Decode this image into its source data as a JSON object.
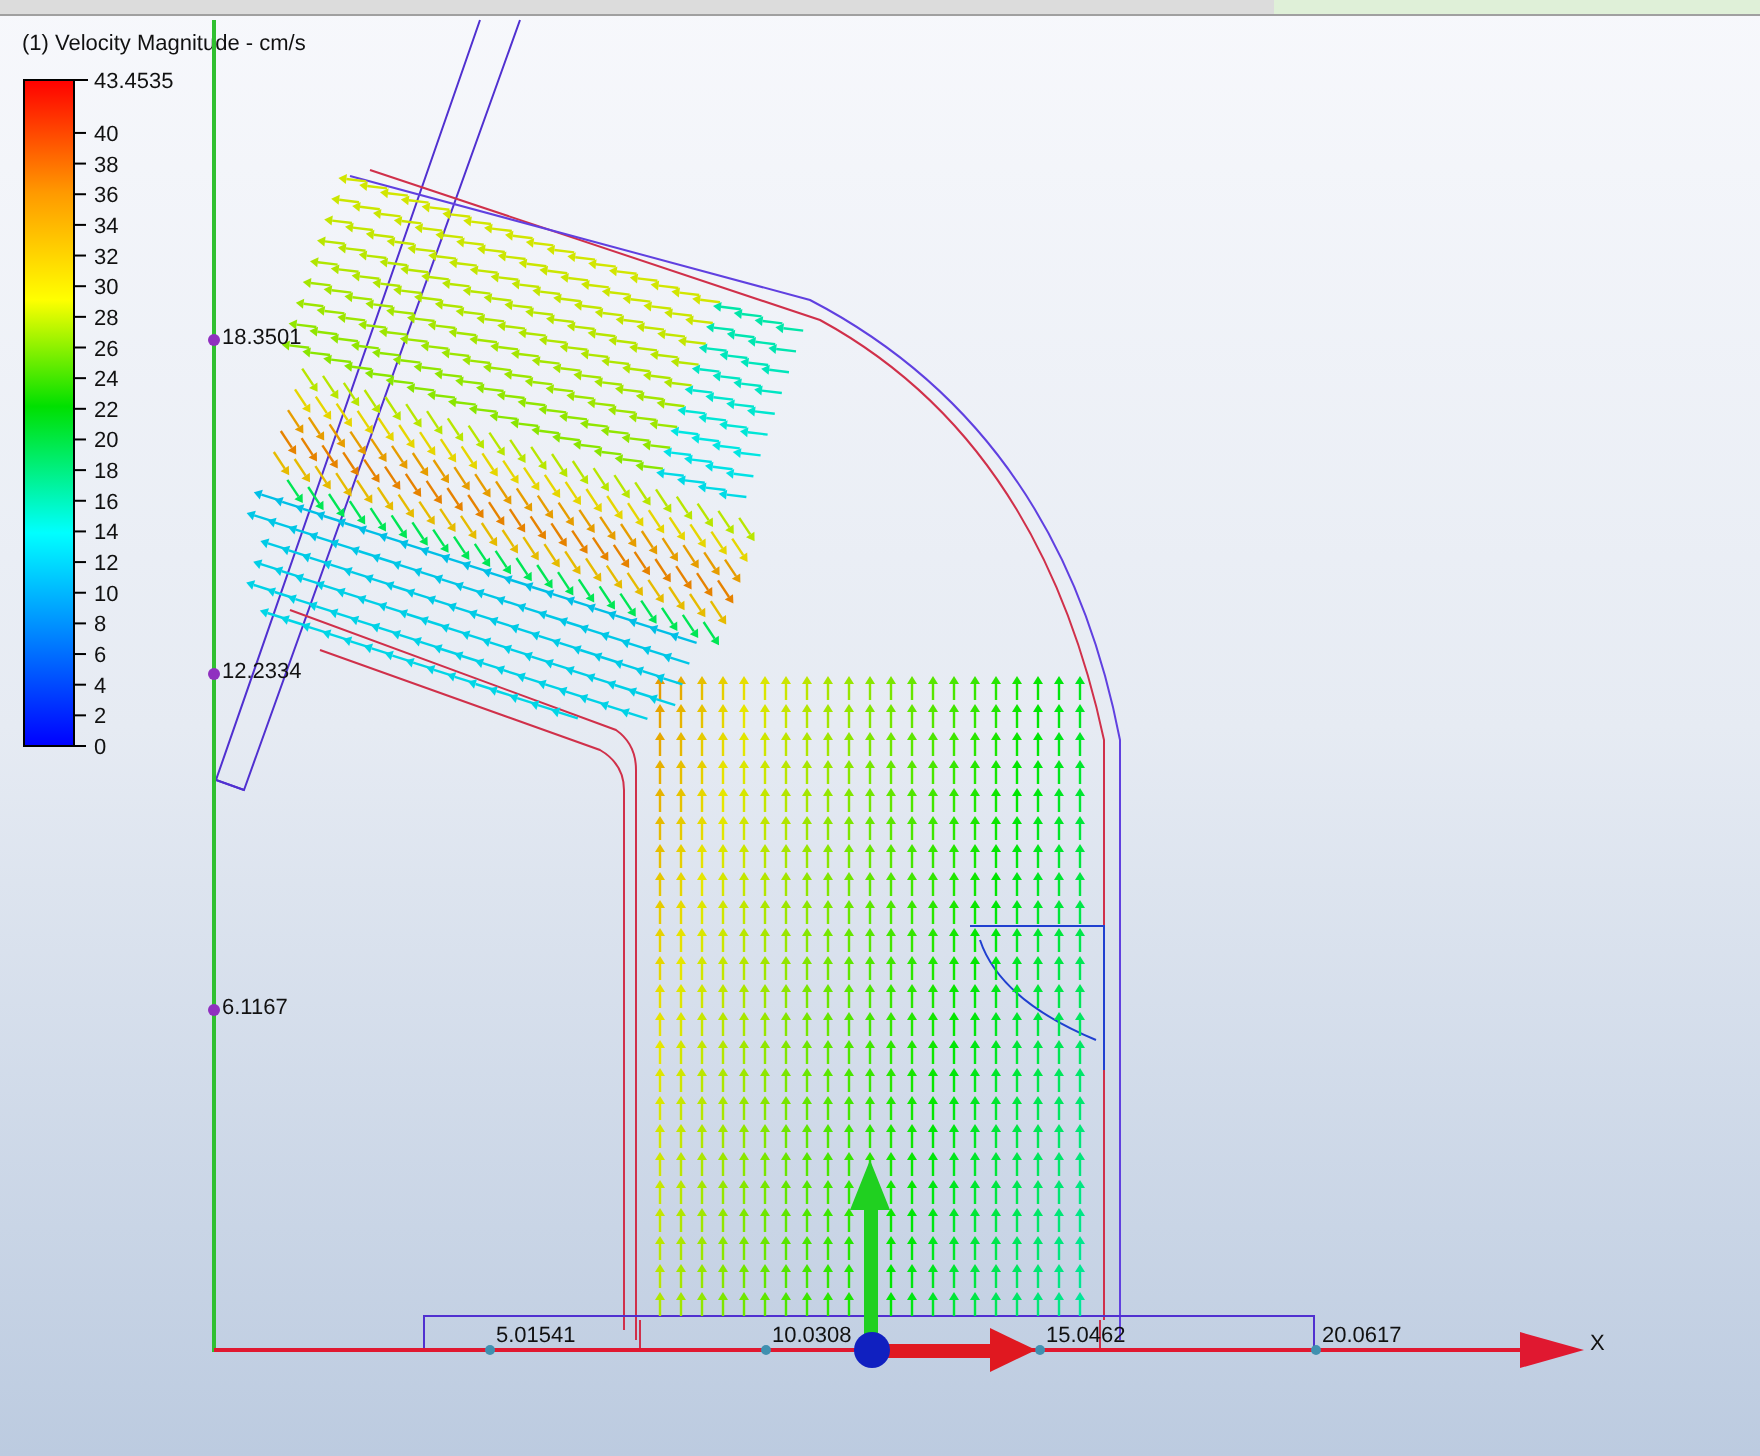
{
  "legend": {
    "title": "(1) Velocity Magnitude - cm/s",
    "max_label": "43.4535",
    "ticks": [
      "40",
      "38",
      "36",
      "34",
      "32",
      "30",
      "28",
      "26",
      "24",
      "22",
      "20",
      "18",
      "16",
      "14",
      "12",
      "10",
      "8",
      "6",
      "4",
      "2",
      "0"
    ]
  },
  "y_axis": {
    "ticks": [
      "18.3501",
      "12.2334",
      "6.1167"
    ]
  },
  "x_axis": {
    "ticks": [
      "5.01541",
      "10.0308",
      "15.0462",
      "20.0617"
    ],
    "label": "X"
  }
}
